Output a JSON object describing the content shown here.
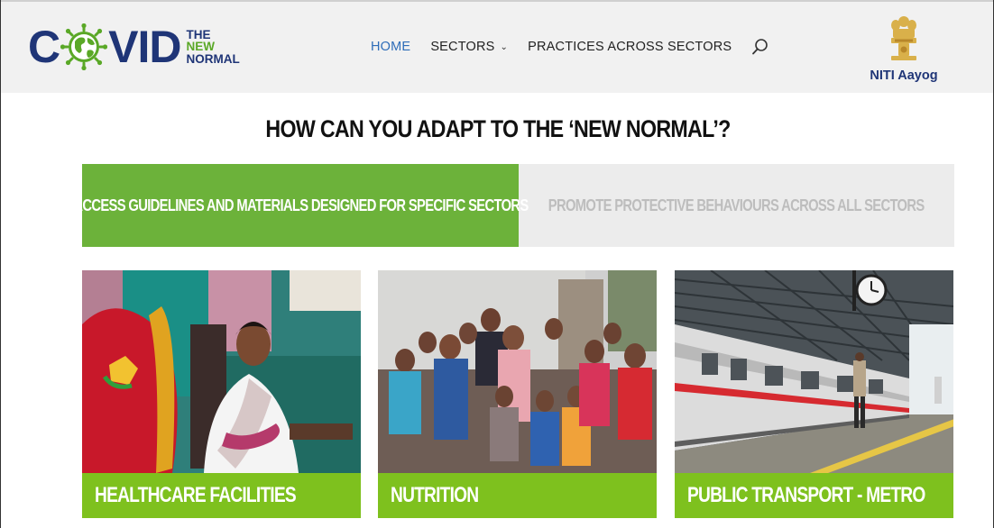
{
  "header": {
    "logo": {
      "part1": "C",
      "part2": "VID",
      "sub1": "THE",
      "sub2": "NEW",
      "sub3": "NORMAL"
    },
    "nav": [
      {
        "label": "HOME",
        "active": true
      },
      {
        "label": "SECTORS",
        "dropdown": true
      },
      {
        "label": "PRACTICES ACROSS SECTORS"
      }
    ],
    "org": "NITI Aayog"
  },
  "headline": "HOW CAN YOU ADAPT TO THE ‘NEW NORMAL’?",
  "tabs": [
    {
      "label": "ACCESS GUIDELINES AND MATERIALS DESIGNED FOR SPECIFIC SECTORS",
      "active": true
    },
    {
      "label": "PROMOTE PROTECTIVE BEHAVIOURS ACROSS ALL SECTORS",
      "active": false
    }
  ],
  "cards": [
    {
      "label": "HEALTHCARE FACILITIES"
    },
    {
      "label": "NUTRITION"
    },
    {
      "label": "PUBLIC TRANSPORT - METRO"
    }
  ],
  "colors": {
    "brand_navy": "#1f3577",
    "brand_green": "#6cb23a",
    "card_label_green": "#7ec11e",
    "nav_active": "#2e6db8"
  }
}
